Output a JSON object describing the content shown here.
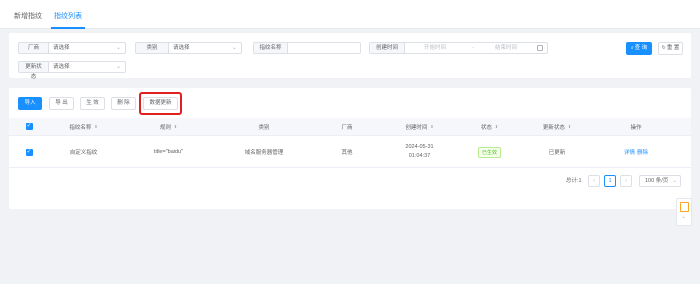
{
  "tabs": [
    "新增指纹",
    "指纹列表"
  ],
  "filters": {
    "vendor": {
      "label": "厂商",
      "value": "请选择"
    },
    "category": {
      "label": "类别",
      "value": "请选择"
    },
    "fp_name": {
      "label": "指纹名称",
      "value": ""
    },
    "created_time": {
      "label": "创建时间",
      "start_placeholder": "开始时间",
      "separator": "-",
      "end_placeholder": "结束时间"
    },
    "update_status": {
      "label": "更新状态",
      "value": "请选择"
    },
    "query_label": "查 询",
    "reset_label": "重 置"
  },
  "toolbar": {
    "import_label": "导入",
    "export_label": "导 出",
    "generate_label": "生 效",
    "delete_label": "删 除",
    "update_data_label": "数据更新"
  },
  "table": {
    "headers": [
      "指纹名称",
      "规则",
      "类别",
      "厂商",
      "创建时间",
      "状态",
      "更新状态",
      "操作"
    ],
    "rows": [
      {
        "name": "自定义指纹",
        "rule": "title=\"baidu\"",
        "category": "域名服务器管理",
        "vendor": "其他",
        "created_date": "2024-05-31",
        "created_time": "01:04:37",
        "status": "已生效",
        "update_status": "已更新",
        "action_detail": "详情",
        "action_delete": "删除"
      }
    ]
  },
  "pagination": {
    "total_label": "总计:1",
    "current_page": "1",
    "page_size": "100 条/页"
  },
  "colors": {
    "primary": "#1890ff",
    "highlight": "#e02020",
    "success": "#52c41a"
  }
}
